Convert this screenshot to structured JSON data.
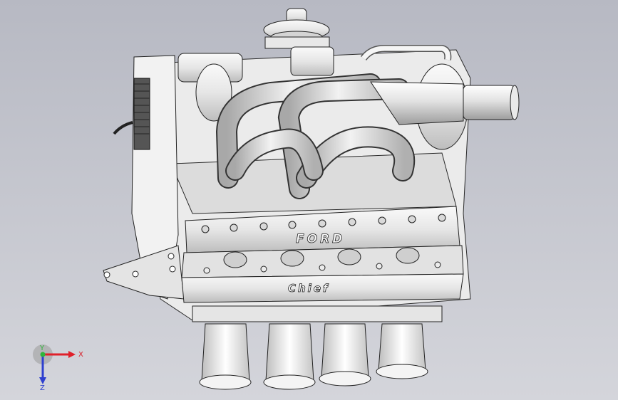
{
  "viewport": {
    "background_top": "#b7b9c3",
    "background_bottom": "#d4d5db"
  },
  "model": {
    "cam_cover_logo": "FORD",
    "sump_logo": "Chief"
  },
  "triad": {
    "x_label": "X",
    "y_label": "Y",
    "z_label": "Z",
    "x_color": "#e0202a",
    "y_color": "#2fb53a",
    "z_color": "#2e3fcf"
  }
}
